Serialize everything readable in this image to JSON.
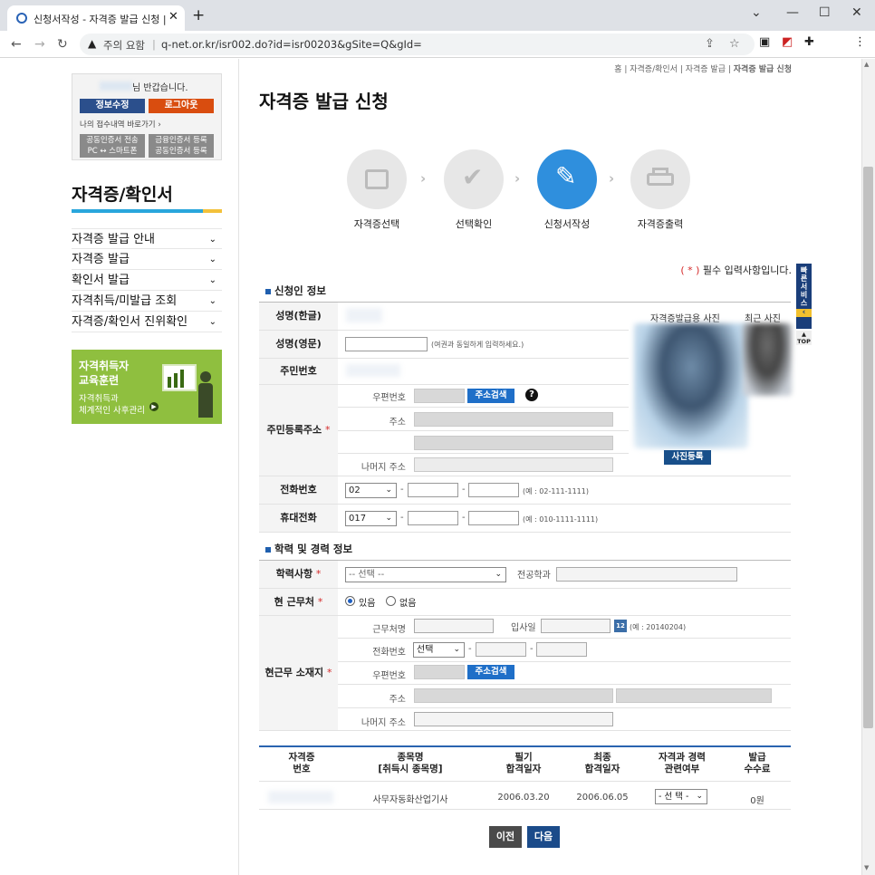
{
  "browser": {
    "tab_title": "신청서작성 - 자격증 발급 신청 |",
    "security_label": "주의 요함",
    "url": "q-net.or.kr/isr002.do?id=isr00203&gSite=Q&gId="
  },
  "sidebar": {
    "greeting": "님 반갑습니다.",
    "edit_info": "정보수정",
    "logout": "로그아웃",
    "my_history": "나의 접수내역 바로가기",
    "cert_btn1_line1": "공동인증서 전송",
    "cert_btn1_line2": "PC ↔ 스마트폰",
    "cert_btn2_line1": "금융인증서 등록",
    "cert_btn2_line2": "공동인증서 등록",
    "section_title": "자격증/확인서",
    "menu": [
      "자격증 발급 안내",
      "자격증 발급",
      "확인서 발급",
      "자격취득/미발급 조회",
      "자격증/확인서 진위확인"
    ],
    "banner_line1": "자격취득자",
    "banner_line2": "교육훈련",
    "banner_line3": "자격취득과",
    "banner_line4": "체계적인 사후관리"
  },
  "breadcrumb": {
    "home": "홈",
    "c1": "자격증/확인서",
    "c2": "자격증 발급",
    "c3": "자격증 발급 신청"
  },
  "page_title": "자격증 발급 신청",
  "steps": [
    {
      "label": "자격증선택",
      "icon": "id-card-icon"
    },
    {
      "label": "선택확인",
      "icon": "check-icon"
    },
    {
      "label": "신청서작성",
      "icon": "pencil-icon"
    },
    {
      "label": "자격증출력",
      "icon": "printer-icon"
    }
  ],
  "required_note": "필수 입력사항입니다.",
  "required_mark": "( * )",
  "applicant": {
    "section": "신청인 정보",
    "name_kr": "성명(한글)",
    "name_en": "성명(영문)",
    "name_en_hint": "(여권과 동일하게 입력하세요.)",
    "rrn": "주민번호",
    "address": "주민등록주소",
    "postcode": "우편번호",
    "addr_search": "주소검색",
    "addr": "주소",
    "addr_rest": "나머지 주소",
    "phone": "전화번호",
    "phone_area": "02",
    "phone_hint": "(예 : 02-111-1111)",
    "mobile": "휴대전화",
    "mobile_area": "017",
    "mobile_hint": "(예 : 010-1111-1111)",
    "photo_label": "자격증발급용 사진",
    "recent_photo": "최근 사진",
    "photo_register": "사진등록"
  },
  "education": {
    "section": "학력 및 경력 정보",
    "edu_level": "학력사항",
    "edu_select": "-- 선택 --",
    "major": "전공학과",
    "workplace": "현 근무처",
    "yes": "있음",
    "no": "없음",
    "workplace_addr": "현근무 소재지",
    "company": "근무처명",
    "hire_date": "입사일",
    "calendar": "12",
    "hire_hint": "(예 : 20140204)",
    "phone": "전화번호",
    "phone_select": "선택",
    "postcode": "우편번호",
    "addr_search": "주소검색",
    "addr": "주소",
    "addr_rest": "나머지 주소"
  },
  "table": {
    "headers": [
      [
        "자격증",
        "번호"
      ],
      [
        "종목명",
        "[취득시 종목명]"
      ],
      [
        "필기",
        "합격일자"
      ],
      [
        "최종",
        "합격일자"
      ],
      [
        "자격과 경력",
        "관련여부"
      ],
      [
        "발급",
        "수수료"
      ]
    ],
    "row": {
      "name": "사무자동화산업기사",
      "written": "2006.03.20",
      "final": "2006.06.05",
      "related": "- 선 택 -",
      "fee": "0원"
    }
  },
  "buttons": {
    "prev": "이전",
    "next": "다음"
  },
  "quick_service": "빠른서비스",
  "top": "TOP"
}
